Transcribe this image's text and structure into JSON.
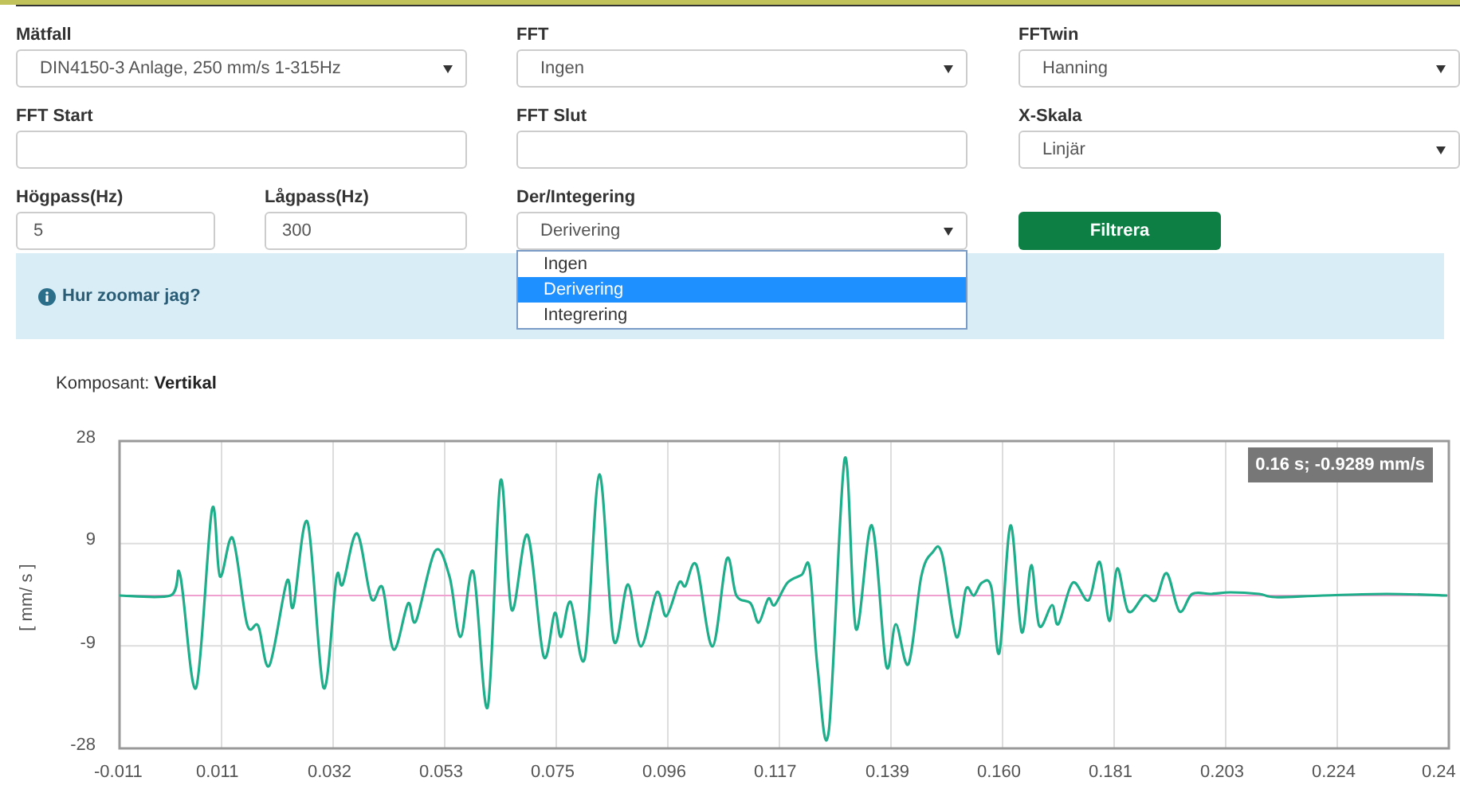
{
  "form": {
    "matfall": {
      "label": "Mätfall",
      "value": "DIN4150-3 Anlage, 250 mm/s 1-315Hz"
    },
    "fft": {
      "label": "FFT",
      "value": "Ingen"
    },
    "fftwin": {
      "label": "FFTwin",
      "value": "Hanning"
    },
    "fft_start": {
      "label": "FFT Start"
    },
    "fft_slut": {
      "label": "FFT Slut"
    },
    "x_skala": {
      "label": "X-Skala",
      "value": "Linjär"
    },
    "hogpass": {
      "label": "Högpass(Hz)",
      "value": "5"
    },
    "lagpass": {
      "label": "Lågpass(Hz)",
      "value": "300"
    },
    "der_integrering": {
      "label": "Der/Integering",
      "value": "Derivering",
      "expanded": true,
      "options": [
        {
          "label": "Ingen",
          "selected": false
        },
        {
          "label": "Derivering",
          "selected": true
        },
        {
          "label": "Integrering",
          "selected": false
        }
      ]
    },
    "filter_button": "Filtrera"
  },
  "info": {
    "text": "Hur zoomar jag?"
  },
  "component": {
    "label": "Komposant:",
    "value": "Vertikal"
  },
  "chart": {
    "ylabel": "[ mm/ s ]",
    "yticks": [
      "28",
      "9",
      "-9",
      "-28"
    ],
    "xticks": [
      "-0.011",
      "0.011",
      "0.032",
      "0.053",
      "0.075",
      "0.096",
      "0.117",
      "0.139",
      "0.160",
      "0.181",
      "0.203",
      "0.224",
      "0.24"
    ],
    "tooltip": "0.16 s; -0.9289 mm/s"
  }
}
